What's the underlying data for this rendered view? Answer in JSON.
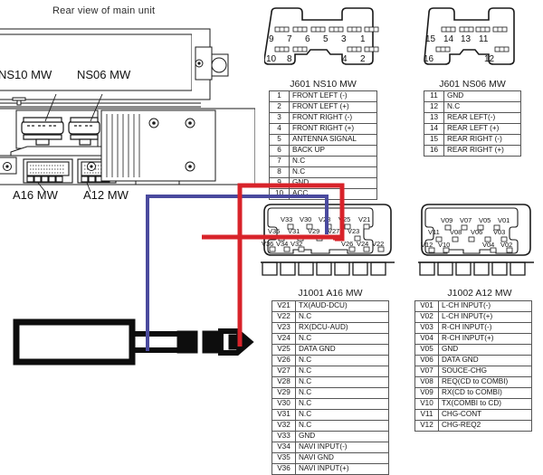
{
  "diagram": {
    "caption": "Rear view of main unit",
    "unit_labels": [
      {
        "id": "ns10",
        "text": "NS10 MW"
      },
      {
        "id": "ns06",
        "text": "NS06 MW"
      },
      {
        "id": "a16",
        "text": "A16 MW"
      },
      {
        "id": "a12",
        "text": "A12 MW"
      }
    ],
    "wire_colors": {
      "blue": "#4a4a9e",
      "red": "#d8232a",
      "outline": "#1a1a1a"
    }
  },
  "connectors": [
    {
      "id": "j601-ns10",
      "title": "J601  NS10 MW",
      "pin_rows": {
        "top": [
          "9",
          "7",
          "6",
          "5",
          "3",
          "1"
        ],
        "bottom_left": [
          "10",
          "8"
        ],
        "bottom_right": [
          "4",
          "2"
        ]
      },
      "pins": [
        {
          "num": "1",
          "desc": "FRONT LEFT (-)"
        },
        {
          "num": "2",
          "desc": "FRONT LEFT (+)"
        },
        {
          "num": "3",
          "desc": "FRONT RIGHT (-)"
        },
        {
          "num": "4",
          "desc": "FRONT RIGHT (+)"
        },
        {
          "num": "5",
          "desc": "ANTENNA SIGNAL"
        },
        {
          "num": "6",
          "desc": "BACK UP"
        },
        {
          "num": "7",
          "desc": "N.C"
        },
        {
          "num": "8",
          "desc": "N.C"
        },
        {
          "num": "9",
          "desc": "GND"
        },
        {
          "num": "10",
          "desc": "ACC"
        }
      ]
    },
    {
      "id": "j601-ns06",
      "title": "J601  NS06 MW",
      "pin_rows": {
        "top": [
          "15",
          "14",
          "13",
          "11"
        ],
        "bottom_left": [
          "16"
        ],
        "bottom_right": [
          "12"
        ]
      },
      "pins": [
        {
          "num": "11",
          "desc": "GND"
        },
        {
          "num": "12",
          "desc": "N.C"
        },
        {
          "num": "13",
          "desc": "REAR LEFT(-)"
        },
        {
          "num": "14",
          "desc": "REAR LEFT (+)"
        },
        {
          "num": "15",
          "desc": "REAR RIGHT (-)"
        },
        {
          "num": "16",
          "desc": "REAR RIGHT (+)"
        }
      ]
    },
    {
      "id": "j1001-a16",
      "title": "J1001  A16 MW",
      "pin_rows": {
        "row1": [
          "V33",
          "V30",
          "V28",
          "V25",
          "V21"
        ],
        "row2": [
          "V35",
          "V31",
          "V29",
          "V27",
          "V23"
        ],
        "row3": [
          "V36",
          "V34",
          "V32",
          "V26",
          "V24",
          "V22"
        ]
      },
      "pins": [
        {
          "num": "V21",
          "desc": "TX(AUD-DCU)"
        },
        {
          "num": "V22",
          "desc": "N.C"
        },
        {
          "num": "V23",
          "desc": "RX(DCU-AUD)"
        },
        {
          "num": "V24",
          "desc": "N.C"
        },
        {
          "num": "V25",
          "desc": "DATA GND"
        },
        {
          "num": "V26",
          "desc": "N.C"
        },
        {
          "num": "V27",
          "desc": "N.C"
        },
        {
          "num": "V28",
          "desc": "N.C"
        },
        {
          "num": "V29",
          "desc": "N.C"
        },
        {
          "num": "V30",
          "desc": "N.C"
        },
        {
          "num": "V31",
          "desc": "N.C"
        },
        {
          "num": "V32",
          "desc": "N.C"
        },
        {
          "num": "V33",
          "desc": "GND"
        },
        {
          "num": "V34",
          "desc": "NAVI INPUT(-)"
        },
        {
          "num": "V35",
          "desc": "NAVI GND"
        },
        {
          "num": "V36",
          "desc": "NAVI INPUT(+)"
        }
      ]
    },
    {
      "id": "j1002-a12",
      "title": "J1002  A12 MW",
      "pin_rows": {
        "row1": [
          "V09",
          "V07",
          "V05",
          "V01"
        ],
        "row2": [
          "V11",
          "V08",
          "V06",
          "V03"
        ],
        "row3": [
          "V12",
          "V10",
          "V04",
          "V02"
        ]
      },
      "pins": [
        {
          "num": "V01",
          "desc": "L-CH INPUT(-)"
        },
        {
          "num": "V02",
          "desc": "L-CH INPUT(+)"
        },
        {
          "num": "V03",
          "desc": "R-CH INPUT(-)"
        },
        {
          "num": "V04",
          "desc": "R-CH INPUT(+)"
        },
        {
          "num": "V05",
          "desc": "GND"
        },
        {
          "num": "V06",
          "desc": "DATA GND"
        },
        {
          "num": "V07",
          "desc": "SOUCE-CHG"
        },
        {
          "num": "V08",
          "desc": "REQ(CD to COMBI)"
        },
        {
          "num": "V09",
          "desc": "RX(CD to COMBI)"
        },
        {
          "num": "V10",
          "desc": "TX(COMBI to CD)"
        },
        {
          "num": "V11",
          "desc": "CHG-CONT"
        },
        {
          "num": "V12",
          "desc": "CHG-REQ2"
        }
      ]
    }
  ]
}
